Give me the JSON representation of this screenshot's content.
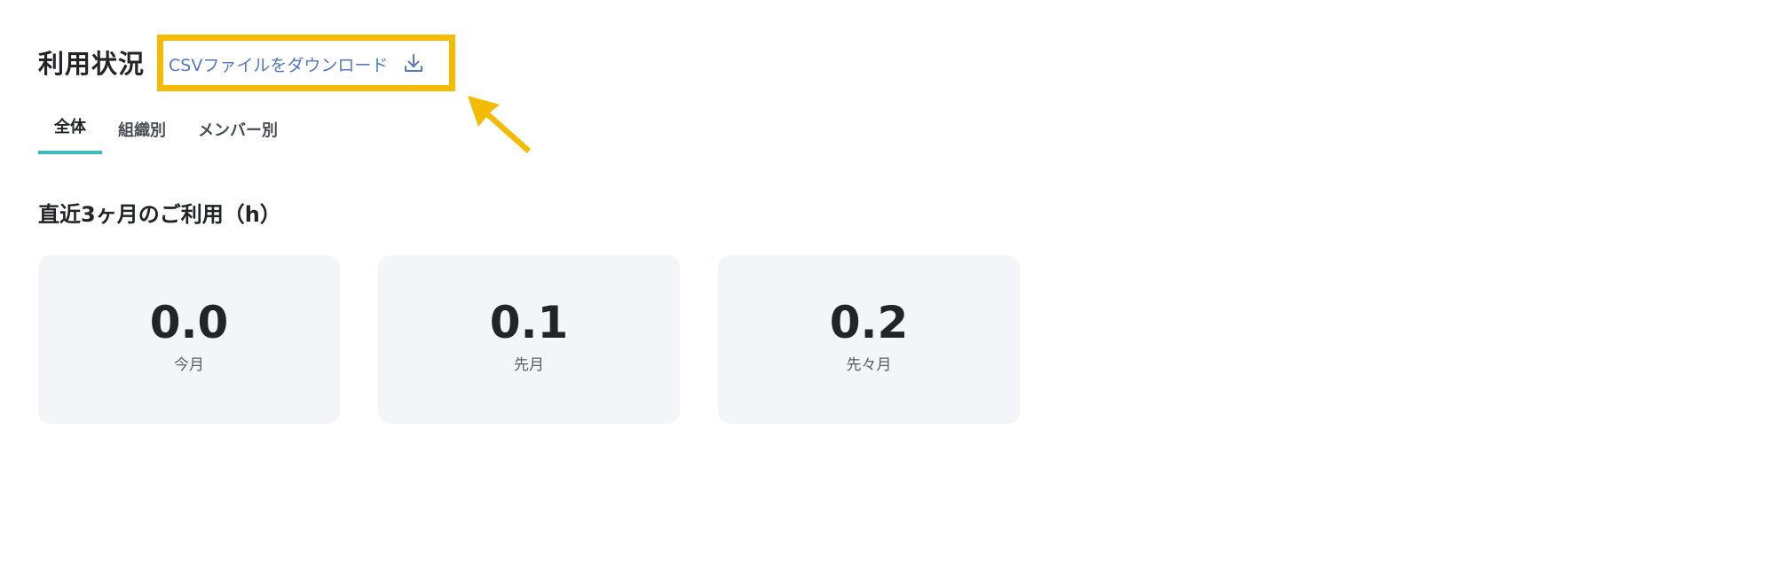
{
  "header": {
    "title": "利用状況",
    "csv_download_label": "CSVファイルをダウンロード",
    "download_icon": "download-icon"
  },
  "tabs": [
    {
      "label": "全体",
      "active": true
    },
    {
      "label": "組織別",
      "active": false
    },
    {
      "label": "メンバー別",
      "active": false
    }
  ],
  "usage": {
    "section_title": "直近3ヶ月のご利用（h）",
    "cards": [
      {
        "value": "0.0",
        "label": "今月"
      },
      {
        "value": "0.1",
        "label": "先月"
      },
      {
        "value": "0.2",
        "label": "先々月"
      }
    ]
  },
  "colors": {
    "accent_tab": "#3fb8be",
    "link": "#5578c4",
    "annotation": "#f5bb00",
    "card_bg": "#f3f5f8"
  }
}
